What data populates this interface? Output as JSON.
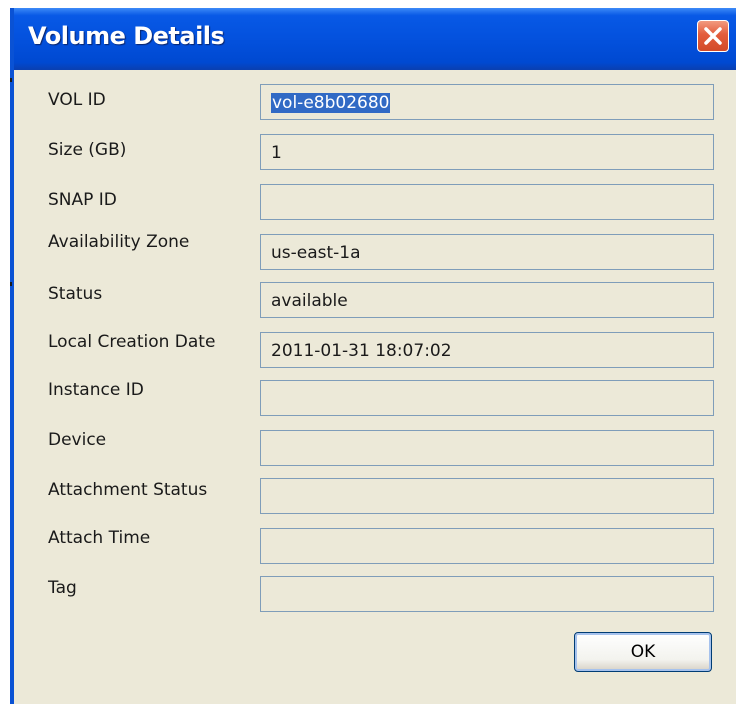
{
  "window": {
    "title": "Volume Details"
  },
  "fields": [
    {
      "label": "VOL ID",
      "value": "vol-e8b02680"
    },
    {
      "label": "Size (GB)",
      "value": "1"
    },
    {
      "label": "SNAP ID",
      "value": ""
    },
    {
      "label": "Availability Zone",
      "value": "us-east-1a"
    },
    {
      "label": "Status",
      "value": "available"
    },
    {
      "label": "Local Creation Date",
      "value": "2011-01-31 18:07:02"
    },
    {
      "label": "Instance ID",
      "value": ""
    },
    {
      "label": "Device",
      "value": ""
    },
    {
      "label": "Attachment Status",
      "value": ""
    },
    {
      "label": "Attach Time",
      "value": ""
    },
    {
      "label": "Tag",
      "value": ""
    }
  ],
  "buttons": {
    "ok_label": "OK"
  },
  "colors": {
    "titlebar": "#0350dc",
    "dialog_background": "#ece9d8",
    "field_border": "#7f9db9",
    "selection": "#316ac5",
    "close_button": "#e35c3b"
  },
  "icons": {
    "close": "close-icon"
  }
}
